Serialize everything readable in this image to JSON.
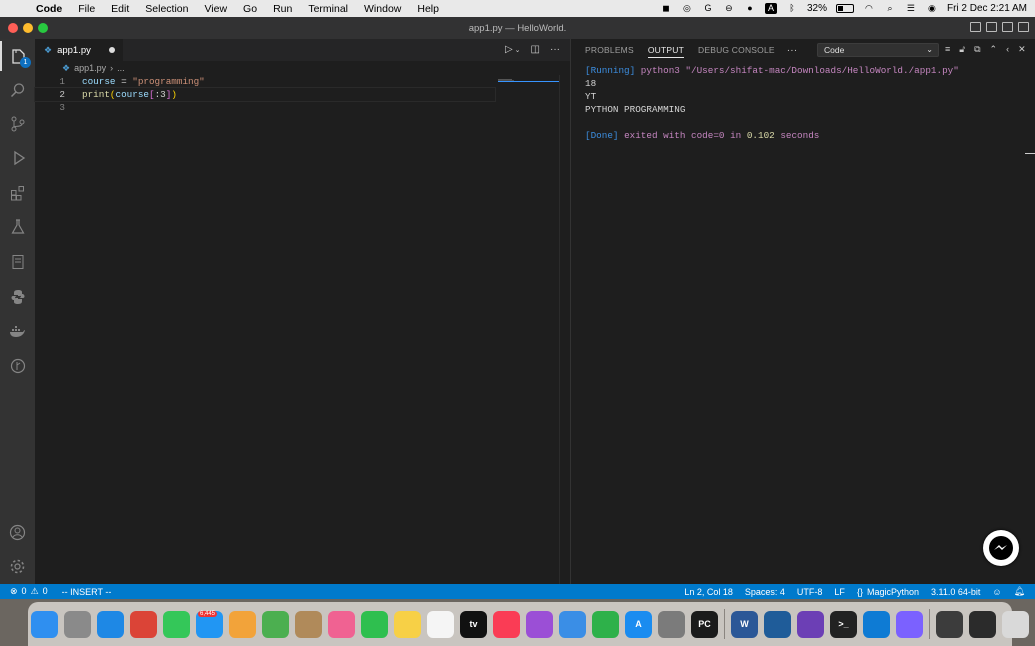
{
  "menubar": {
    "app_name": "Code",
    "items": [
      "File",
      "Edit",
      "Selection",
      "View",
      "Go",
      "Run",
      "Terminal",
      "Window",
      "Help"
    ],
    "battery": "32%",
    "datetime": "Fri 2 Dec  2:21 AM"
  },
  "window": {
    "title": "app1.py — HelloWorld."
  },
  "activity_bar": {
    "explorer_badge": "1",
    "icons": [
      "explorer-icon",
      "search-icon",
      "source-control-icon",
      "run-debug-icon",
      "extensions-icon",
      "testing-icon",
      "notebook-icon",
      "python-icon",
      "docker-icon",
      "git-graph-icon",
      "account-icon",
      "settings-gear-icon"
    ]
  },
  "editor": {
    "tab_label": "app1.py",
    "breadcrumb": "app1.py",
    "breadcrumb_more": "...",
    "line_numbers": [
      "1",
      "2",
      "3"
    ],
    "code": {
      "l1_var": "course",
      "l1_op": " = ",
      "l1_str": "\"programming\"",
      "l2_fn": "print",
      "l2_open": "(",
      "l2_var": "course",
      "l2_open_b": "[",
      "l2_slice": ":3",
      "l2_close_b": "]",
      "l2_close": ")"
    }
  },
  "panel": {
    "tabs": [
      "PROBLEMS",
      "OUTPUT",
      "DEBUG CONSOLE"
    ],
    "active_tab": "OUTPUT",
    "more": "···",
    "channel_select": "Code",
    "output": {
      "running_tag": "[Running]",
      "running_cmd": " python3 \"/Users/shifat-mac/Downloads/HelloWorld./app1.py\"",
      "line1": "18",
      "line2": "YT",
      "line3": "PYTHON PROGRAMMING",
      "done_tag": "[Done]",
      "done_exited": " exited with ",
      "done_code": "code=0",
      "done_in": " in ",
      "done_time": "0.102",
      "done_seconds": " seconds"
    }
  },
  "statusbar": {
    "errors": "0",
    "warnings": "0",
    "mode": "-- INSERT --",
    "position": "Ln 2, Col 18",
    "spaces": "Spaces: 4",
    "encoding": "UTF-8",
    "eol": "LF",
    "language": "MagicPython",
    "interpreter": "3.11.0 64-bit"
  },
  "dock": {
    "mail_badge": "6,445",
    "apps": [
      {
        "name": "finder",
        "color": "#2f8ff0",
        "label": ""
      },
      {
        "name": "launchpad",
        "color": "#8a8a8a",
        "label": ""
      },
      {
        "name": "safari",
        "color": "#1e88e5",
        "label": ""
      },
      {
        "name": "chrome",
        "color": "#db4437",
        "label": ""
      },
      {
        "name": "messages",
        "color": "#34c759",
        "label": ""
      },
      {
        "name": "mail",
        "color": "#2196f3",
        "label": ""
      },
      {
        "name": "pages-pencil",
        "color": "#f2a33a",
        "label": ""
      },
      {
        "name": "maps",
        "color": "#4caf50",
        "label": ""
      },
      {
        "name": "contacts",
        "color": "#b08a5a",
        "label": ""
      },
      {
        "name": "photos",
        "color": "#f06292",
        "label": ""
      },
      {
        "name": "facetime",
        "color": "#2fbf4f",
        "label": ""
      },
      {
        "name": "notes",
        "color": "#f7d046",
        "label": ""
      },
      {
        "name": "reminders",
        "color": "#f5f5f5",
        "label": ""
      },
      {
        "name": "apple-tv",
        "color": "#111111",
        "label": "tv"
      },
      {
        "name": "music",
        "color": "#fa3c55",
        "label": ""
      },
      {
        "name": "podcasts",
        "color": "#9b4fd6",
        "label": ""
      },
      {
        "name": "keynote",
        "color": "#3a8ee6",
        "label": ""
      },
      {
        "name": "numbers",
        "color": "#2eb14a",
        "label": ""
      },
      {
        "name": "app-store",
        "color": "#1a8cf0",
        "label": "A"
      },
      {
        "name": "system-preferences",
        "color": "#7b7b7b",
        "label": ""
      },
      {
        "name": "pycharm",
        "color": "#1b1b1b",
        "label": "PC"
      },
      {
        "name": "word",
        "color": "#2b5797",
        "label": "W"
      },
      {
        "name": "wireshark",
        "color": "#1f5c99",
        "label": ""
      },
      {
        "name": "visual-studio",
        "color": "#6c3fb5",
        "label": ""
      },
      {
        "name": "terminal",
        "color": "#222222",
        "label": ">_"
      },
      {
        "name": "vscode",
        "color": "#0e7bd4",
        "label": ""
      },
      {
        "name": "messenger",
        "color": "#7b61ff",
        "label": ""
      },
      {
        "name": "recent-window-1",
        "color": "#3c3c3c",
        "label": ""
      },
      {
        "name": "recent-window-2",
        "color": "#2b2b2b",
        "label": ""
      },
      {
        "name": "trash",
        "color": "#d9d9d9",
        "label": ""
      }
    ]
  }
}
